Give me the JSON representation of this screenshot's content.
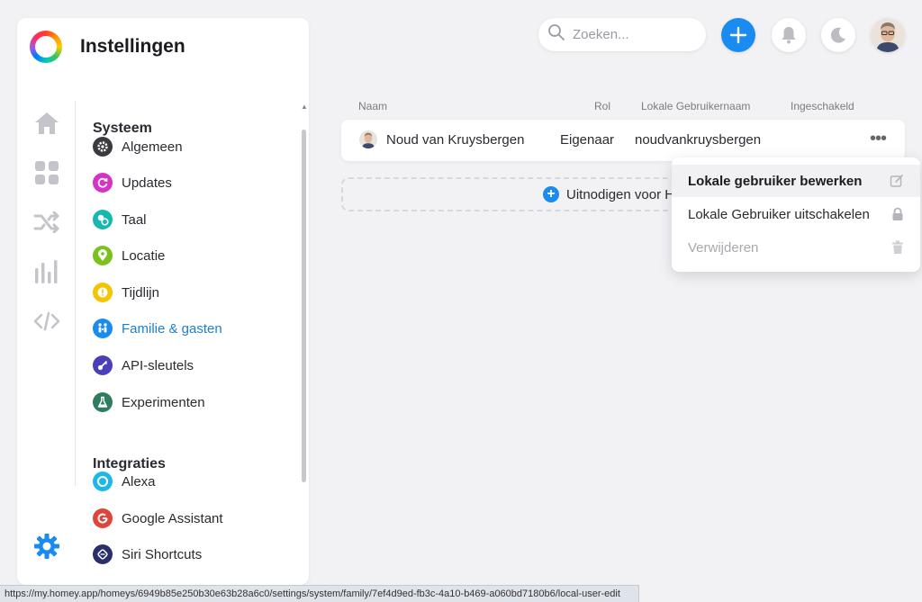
{
  "sidebar": {
    "title": "Instellingen",
    "rail_icons": [
      "home-icon",
      "grid-icon",
      "shuffle-icon",
      "bar-chart-icon",
      "code-icon",
      "gear-icon"
    ],
    "sections": [
      {
        "title": "Systeem",
        "items": [
          {
            "label": "Algemeen",
            "icon": "gear-icon",
            "color": "#3a3a40"
          },
          {
            "label": "Updates",
            "icon": "refresh-icon",
            "color": "#d633c6"
          },
          {
            "label": "Taal",
            "icon": "translate-icon",
            "color": "#16b8b0"
          },
          {
            "label": "Locatie",
            "icon": "location-pin-icon",
            "color": "#7ac21c"
          },
          {
            "label": "Tijdlijn",
            "icon": "alert-icon",
            "color": "#f5c400"
          },
          {
            "label": "Familie & gasten",
            "icon": "family-icon",
            "color": "#1a8cf0",
            "active": true
          },
          {
            "label": "API-sleutels",
            "icon": "key-icon",
            "color": "#4b3fb8"
          },
          {
            "label": "Experimenten",
            "icon": "flask-icon",
            "color": "#2e7d5e"
          }
        ]
      },
      {
        "title": "Integraties",
        "items": [
          {
            "label": "Alexa",
            "icon": "alexa-icon",
            "color": "#1db8e8"
          },
          {
            "label": "Google Assistant",
            "icon": "google-icon",
            "color": "#e0453a"
          },
          {
            "label": "Siri Shortcuts",
            "icon": "siri-icon",
            "color": "#2a2f6a"
          }
        ]
      }
    ]
  },
  "topbar": {
    "search_placeholder": "Zoeken..."
  },
  "table": {
    "headers": [
      "Naam",
      "Rol",
      "Lokale Gebruikernaam",
      "Ingeschakeld"
    ],
    "row": {
      "name": "Noud van Kruysbergen",
      "role": "Eigenaar",
      "username": "noudvankruysbergen"
    },
    "invite_label": "Uitnodigen voor H"
  },
  "context_menu": {
    "items": [
      {
        "label": "Lokale gebruiker bewerken",
        "icon": "edit-icon"
      },
      {
        "label": "Lokale Gebruiker uitschakelen",
        "icon": "lock-icon"
      },
      {
        "label": "Verwijderen",
        "icon": "trash-icon",
        "disabled": true
      }
    ]
  },
  "status_bar": {
    "url": "https://my.homey.app/homeys/6949b85e250b30e63b28a6c0/settings/system/family/7ef4d9ed-fb3c-4a10-b469-a060bd7180b6/local-user-edit"
  },
  "colors": {
    "accent": "#1a8cf0",
    "background": "#f2f2f5"
  }
}
